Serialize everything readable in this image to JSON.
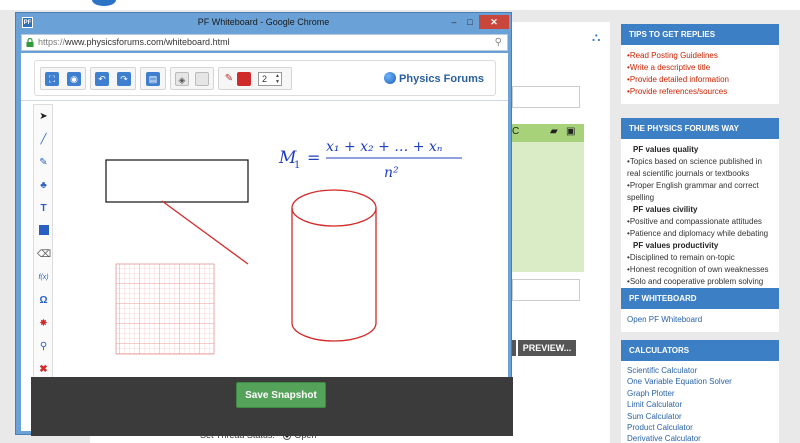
{
  "window": {
    "badge": "PF",
    "title": "PF Whiteboard - Google Chrome",
    "controls": {
      "minimize": "–",
      "maximize": "□",
      "close": "✕"
    }
  },
  "address": {
    "scheme": "https://",
    "rest": "www.physicsforums.com/whiteboard.html"
  },
  "toolbar": {
    "line_width": "2",
    "brand": "Physics Forums",
    "icons": [
      "expand-icon",
      "settings-icon",
      "undo-icon",
      "redo-icon",
      "snapshot-icon",
      "fill-bucket-icon",
      "clear-icon",
      "pencil-color-icon",
      "color-swatch-icon"
    ]
  },
  "palette": {
    "icons": [
      "pointer-icon",
      "line-icon",
      "pencil-icon",
      "shapes-icon",
      "text-icon",
      "rectangle-icon",
      "eraser-icon",
      "function-icon",
      "omega-icon",
      "stamp-icon",
      "zoom-icon",
      "delete-icon"
    ],
    "function_label": "f(x)",
    "omega_label": "Ω",
    "text_label": "T"
  },
  "canvas": {
    "formula_lhs": "M",
    "formula_lhs_sub": "1",
    "formula_eq": "=",
    "formula_numerator": "x₁ + x₂ + … + xₙ",
    "formula_denominator": "n²"
  },
  "footer": {
    "save_label": "Save Snapshot"
  },
  "background": {
    "preview_label": "PREVIEW...",
    "status_label": "Set Thread Status:",
    "status_value": "Open",
    "tips": {
      "header": "TIPS TO GET REPLIES",
      "items": [
        "Read Posting Guidelines",
        "Write a descriptive title",
        "Provide detailed information",
        "Provide references/sources"
      ]
    },
    "way": {
      "header": "THE PHYSICS FORUMS WAY",
      "sub1": "PF values quality",
      "items1": [
        "Topics based on science published in real scientific journals or textbooks",
        "Proper English grammar and correct spelling"
      ],
      "sub2": "PF values civility",
      "items2": [
        "Positive and compassionate attitudes",
        "Patience and diplomacy while debating"
      ],
      "sub3": "PF values productivity",
      "items3": [
        "Disciplined to remain on-topic",
        "Honest recognition of own weaknesses",
        "Solo and cooperative problem solving"
      ]
    },
    "whiteboard": {
      "header": "PF WHITEBOARD",
      "link": "Open PF Whiteboard"
    },
    "calculators": {
      "header": "CALCULATORS",
      "items": [
        "Scientific Calculator",
        "One Variable Equation Solver",
        "Graph Plotter",
        "Limit Calculator",
        "Sum Calculator",
        "Product Calculator",
        "Derivative Calculator"
      ]
    }
  },
  "colors": {
    "accent": "#3d7fc4",
    "pen_red": "#d42a2a",
    "formula_blue": "#1f3fbf",
    "save_green": "#55a35a",
    "footer_dark": "#3b3b3b",
    "tips_red": "#cc2200"
  }
}
